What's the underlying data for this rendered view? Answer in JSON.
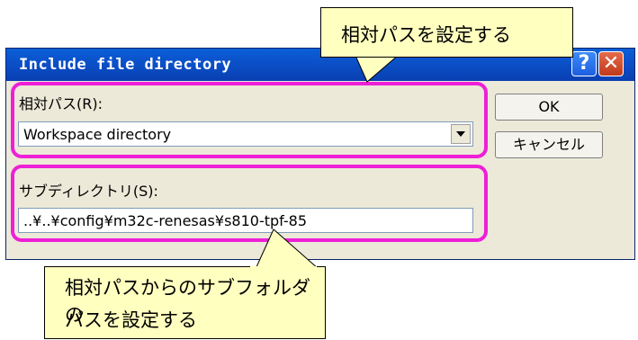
{
  "dialog": {
    "title": "Include file directory",
    "help_glyph": "?",
    "close_glyph": "✕",
    "relative_path_label": "相対パス(R):",
    "relative_path_value": "Workspace directory",
    "subdirectory_label": "サブディレクトリ(S):",
    "subdirectory_value": "..¥..¥config¥m32c-renesas¥s810-tpf-85",
    "ok_label": "OK",
    "cancel_label": "キャンセル"
  },
  "callouts": {
    "top": "相対パスを設定する",
    "bottom_line1": "相対パスからのサブフォルダの",
    "bottom_line2": "パスを設定する"
  },
  "colors": {
    "highlight": "#ee1fd7",
    "callout_fill": "#ffffc0",
    "titlebar": "#0b50c8"
  }
}
